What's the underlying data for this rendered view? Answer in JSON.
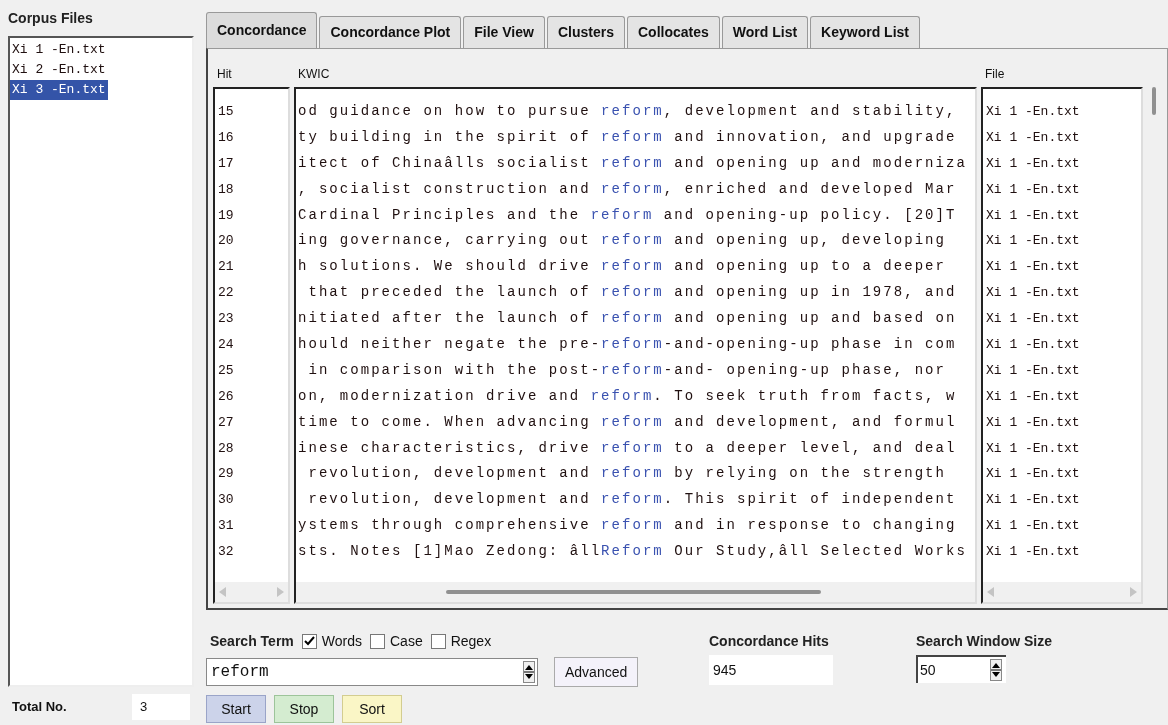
{
  "corpus_files": {
    "title": "Corpus Files",
    "items": [
      {
        "label": "Xi 1 -En.txt",
        "selected": false
      },
      {
        "label": "Xi 2 -En.txt",
        "selected": false
      },
      {
        "label": "Xi 3 -En.txt",
        "selected": true
      }
    ],
    "total_label": "Total No.",
    "total_value": "3"
  },
  "tabs": [
    {
      "label": "Concordance",
      "selected": true
    },
    {
      "label": "Concordance Plot",
      "selected": false
    },
    {
      "label": "File View",
      "selected": false
    },
    {
      "label": "Clusters",
      "selected": false
    },
    {
      "label": "Collocates",
      "selected": false
    },
    {
      "label": "Word List",
      "selected": false
    },
    {
      "label": "Keyword List",
      "selected": false
    }
  ],
  "table": {
    "columns": [
      "Hit",
      "KWIC",
      "File"
    ],
    "rows": [
      {
        "hit": "15",
        "left": "od guidance on how to pursue ",
        "keyword": "reform",
        "right": ", development and stability,",
        "file": "Xi 1 -En.txt"
      },
      {
        "hit": "16",
        "left": "ty building in the spirit of ",
        "keyword": "reform",
        "right": " and innovation, and upgrade",
        "file": "Xi 1 -En.txt"
      },
      {
        "hit": "17",
        "left": "itect of Chinaâlls socialist ",
        "keyword": "reform",
        "right": " and opening up and moderniza",
        "file": "Xi 1 -En.txt"
      },
      {
        "hit": "18",
        "left": ", socialist construction and ",
        "keyword": "reform",
        "right": ", enriched and developed Mar",
        "file": "Xi 1 -En.txt"
      },
      {
        "hit": "19",
        "left": "Cardinal Principles and the ",
        "keyword": "reform",
        "right": " and opening-up policy. [20]T",
        "file": "Xi 1 -En.txt"
      },
      {
        "hit": "20",
        "left": "ing governance, carrying out ",
        "keyword": "reform",
        "right": " and opening up, developing",
        "file": "Xi 1 -En.txt"
      },
      {
        "hit": "21",
        "left": "h solutions. We should drive ",
        "keyword": "reform",
        "right": " and opening up to a deeper",
        "file": "Xi 1 -En.txt"
      },
      {
        "hit": "22",
        "left": " that preceded the launch of ",
        "keyword": "reform",
        "right": " and opening up in 1978, and",
        "file": "Xi 1 -En.txt"
      },
      {
        "hit": "23",
        "left": "nitiated after the launch of ",
        "keyword": "reform",
        "right": " and opening up and based on",
        "file": "Xi 1 -En.txt"
      },
      {
        "hit": "24",
        "left": "hould neither negate the pre-",
        "keyword": "reform",
        "right": "-and-opening-up phase in com",
        "file": "Xi 1 -En.txt"
      },
      {
        "hit": "25",
        "left": " in comparison with the post-",
        "keyword": "reform",
        "right": "-and- opening-up phase, nor",
        "file": "Xi 1 -En.txt"
      },
      {
        "hit": "26",
        "left": "on, modernization drive and ",
        "keyword": "reform",
        "right": ". To seek truth from facts, w",
        "file": "Xi 1 -En.txt"
      },
      {
        "hit": "27",
        "left": "time to come. When advancing ",
        "keyword": "reform",
        "right": " and development, and formul",
        "file": "Xi 1 -En.txt"
      },
      {
        "hit": "28",
        "left": "inese characteristics, drive ",
        "keyword": "reform",
        "right": " to a deeper level, and deal",
        "file": "Xi 1 -En.txt"
      },
      {
        "hit": "29",
        "left": " revolution, development and ",
        "keyword": "reform",
        "right": " by relying on the strength",
        "file": "Xi 1 -En.txt"
      },
      {
        "hit": "30",
        "left": " revolution, development and ",
        "keyword": "reform",
        "right": ". This spirit of independent",
        "file": "Xi 1 -En.txt"
      },
      {
        "hit": "31",
        "left": "ystems through comprehensive ",
        "keyword": "reform",
        "right": " and in response to changing",
        "file": "Xi 1 -En.txt"
      },
      {
        "hit": "32",
        "left": "sts. Notes [1]Mao Zedong: âll",
        "keyword": "Reform",
        "right": " Our Study,âll Selected Works",
        "file": "Xi 1 -En.txt"
      }
    ]
  },
  "search": {
    "label": "Search Term",
    "options": [
      {
        "label": "Words",
        "checked": true
      },
      {
        "label": "Case",
        "checked": false
      },
      {
        "label": "Regex",
        "checked": false
      }
    ],
    "value": "reform",
    "advanced": "Advanced"
  },
  "actions": [
    "Start",
    "Stop",
    "Sort"
  ],
  "hits": {
    "label": "Concordance Hits",
    "value": "945"
  },
  "window_size": {
    "label": "Search Window Size",
    "value": "50"
  }
}
